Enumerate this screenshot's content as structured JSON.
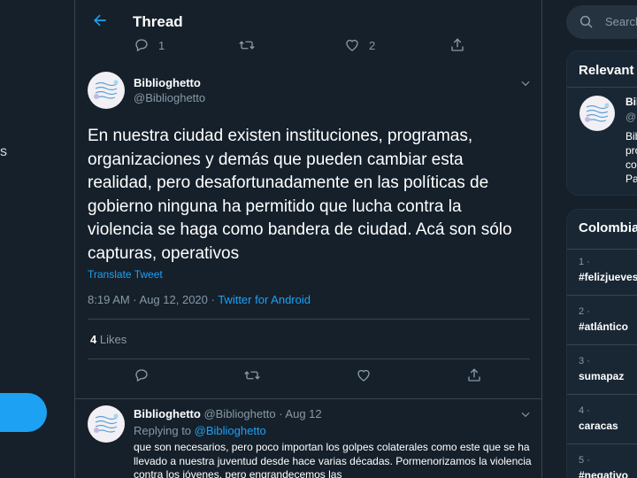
{
  "header": {
    "title": "Thread"
  },
  "top_actions": {
    "replies": "1",
    "likes": "2"
  },
  "focus_tweet": {
    "author_name": "Biblioghetto",
    "author_handle": "@Biblioghetto",
    "text": "En nuestra ciudad existen instituciones, programas, organizaciones y demás que pueden cambiar esta realidad, pero desafortunadamente en las políticas de gobierno ninguna ha permitido que lucha contra la violencia se haga como bandera de ciudad. Acá son sólo capturas, operativos",
    "translate_label": "Translate Tweet",
    "timestamp": "8:19 AM · Aug 12, 2020 · ",
    "source": "Twitter for Android",
    "likes_count": "4",
    "likes_label": " Likes"
  },
  "reply_tweet": {
    "author_name": "Biblioghetto",
    "author_handle": " @Biblioghetto",
    "date": " · Aug 12",
    "replying_label": "Replying to ",
    "replying_handle": "@Biblioghetto",
    "text": "que son necesarios, pero poco importan los golpes colaterales como este que se ha llevado a nuestra juventud desde hace varias décadas. Pormenorizamos la violencia contra los jóvenes, pero engrandecemos las"
  },
  "left_sidebar": {
    "edge_text": "s"
  },
  "search": {
    "placeholder": "Search"
  },
  "relevant": {
    "title": "Relevant",
    "name": "Bibl",
    "handle": "@",
    "bio_lines": [
      "Bib",
      "pro",
      "co",
      "Pa"
    ]
  },
  "trends": {
    "title": "Colombia",
    "items": [
      {
        "rank": "1 ·",
        "name": "#felizjueves"
      },
      {
        "rank": "2 ·",
        "name": "#atlántico"
      },
      {
        "rank": "3 ·",
        "name": "sumapaz"
      },
      {
        "rank": "4 ·",
        "name": "caracas"
      },
      {
        "rank": "5 ·",
        "name": "#negativo"
      }
    ]
  },
  "colors": {
    "background": "#15202b",
    "accent": "#1da1f2",
    "muted": "#8899a6",
    "border": "#38444d"
  }
}
